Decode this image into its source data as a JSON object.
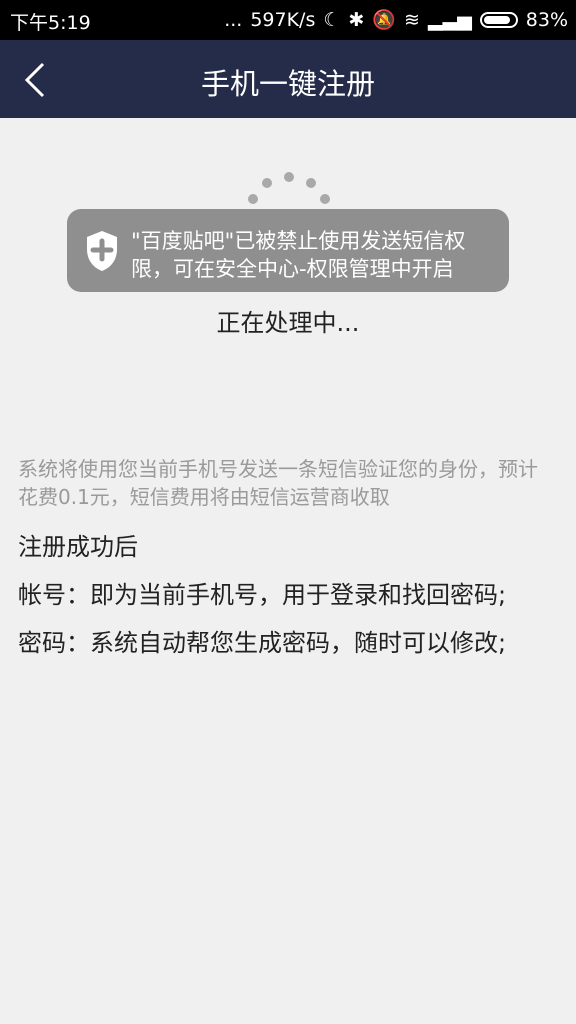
{
  "status_bar": {
    "time": "下午5:19",
    "dots": "...",
    "speed": "597K/s",
    "battery": "83%"
  },
  "header": {
    "title": "手机一键注册"
  },
  "toast": {
    "text": "\"百度贴吧\"已被禁止使用发送短信权限，可在安全中心-权限管理中开启"
  },
  "processing": "正在处理中...",
  "info": "系统将使用您当前手机号发送一条短信验证您的身份，预计花费0.1元，短信费用将由短信运营商收取",
  "after_register": "注册成功后",
  "account_line": "帐号：即为当前手机号，用于登录和找回密码;",
  "password_line": "密码：系统自动帮您生成密码，随时可以修改;"
}
